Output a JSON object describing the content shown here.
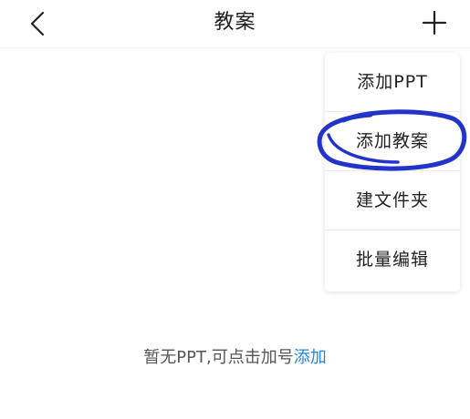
{
  "header": {
    "title": "教案",
    "back_icon": "chevron-left-icon",
    "add_icon": "plus-icon"
  },
  "menu": {
    "items": [
      {
        "label": "添加PPT"
      },
      {
        "label": "添加教案"
      },
      {
        "label": "建文件夹"
      },
      {
        "label": "批量编辑"
      }
    ]
  },
  "empty_state": {
    "text": "暂无PPT,可点击加号",
    "link_text": "添加"
  },
  "colors": {
    "link": "#1e88e5",
    "highlight": "#2233c9"
  }
}
